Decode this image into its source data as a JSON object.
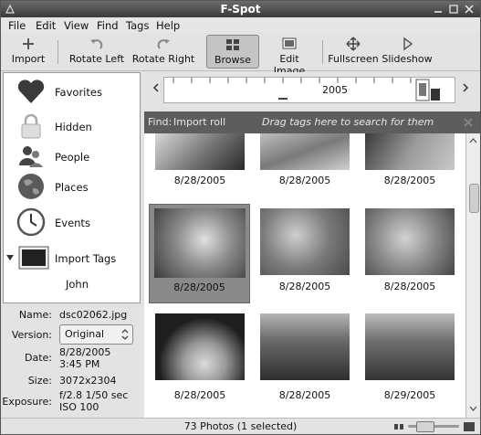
{
  "window": {
    "title": "F-Spot"
  },
  "menubar": {
    "items": [
      "File",
      "Edit",
      "View",
      "Find",
      "Tags",
      "Help"
    ]
  },
  "toolbar": {
    "import": "Import",
    "rotate_left": "Rotate Left",
    "rotate_right": "Rotate Right",
    "browse": "Browse",
    "edit_image": "Edit Image",
    "fullscreen": "Fullscreen",
    "slideshow": "Slideshow"
  },
  "sidebar": {
    "items": [
      {
        "label": "Favorites",
        "icon": "heart-icon"
      },
      {
        "label": "Hidden",
        "icon": "lock-icon"
      },
      {
        "label": "People",
        "icon": "people-icon"
      },
      {
        "label": "Places",
        "icon": "globe-icon"
      },
      {
        "label": "Events",
        "icon": "clock-icon"
      },
      {
        "label": "Import Tags",
        "icon": "photo-tag-icon"
      },
      {
        "label": "John",
        "icon": ""
      }
    ]
  },
  "info": {
    "name_label": "Name:",
    "name": "dsc02062.jpg",
    "version_label": "Version:",
    "version": "Original",
    "date_label": "Date:",
    "date_line1": "8/28/2005",
    "date_line2": "3:45 PM",
    "size_label": "Size:",
    "size": "3072x2304",
    "exposure_label": "Exposure:",
    "exposure_line1": "f/2.8 1/50 sec",
    "exposure_line2": "ISO 100"
  },
  "timeline": {
    "year": "2005"
  },
  "findbar": {
    "label": "Find:",
    "tag": "Import roll",
    "hint": "Drag tags here to search for them"
  },
  "photos": [
    {
      "date": "8/28/2005"
    },
    {
      "date": "8/28/2005"
    },
    {
      "date": "8/28/2005"
    },
    {
      "date": "8/28/2005"
    },
    {
      "date": "8/28/2005"
    },
    {
      "date": "8/28/2005"
    },
    {
      "date": "8/28/2005"
    },
    {
      "date": "8/28/2005"
    },
    {
      "date": "8/29/2005"
    }
  ],
  "status": {
    "text": "73 Photos (1 selected)"
  },
  "colors": {
    "selection": "#8a8a8a",
    "findbar": "#5d5d5d",
    "favorites": "#3a3a3a"
  }
}
